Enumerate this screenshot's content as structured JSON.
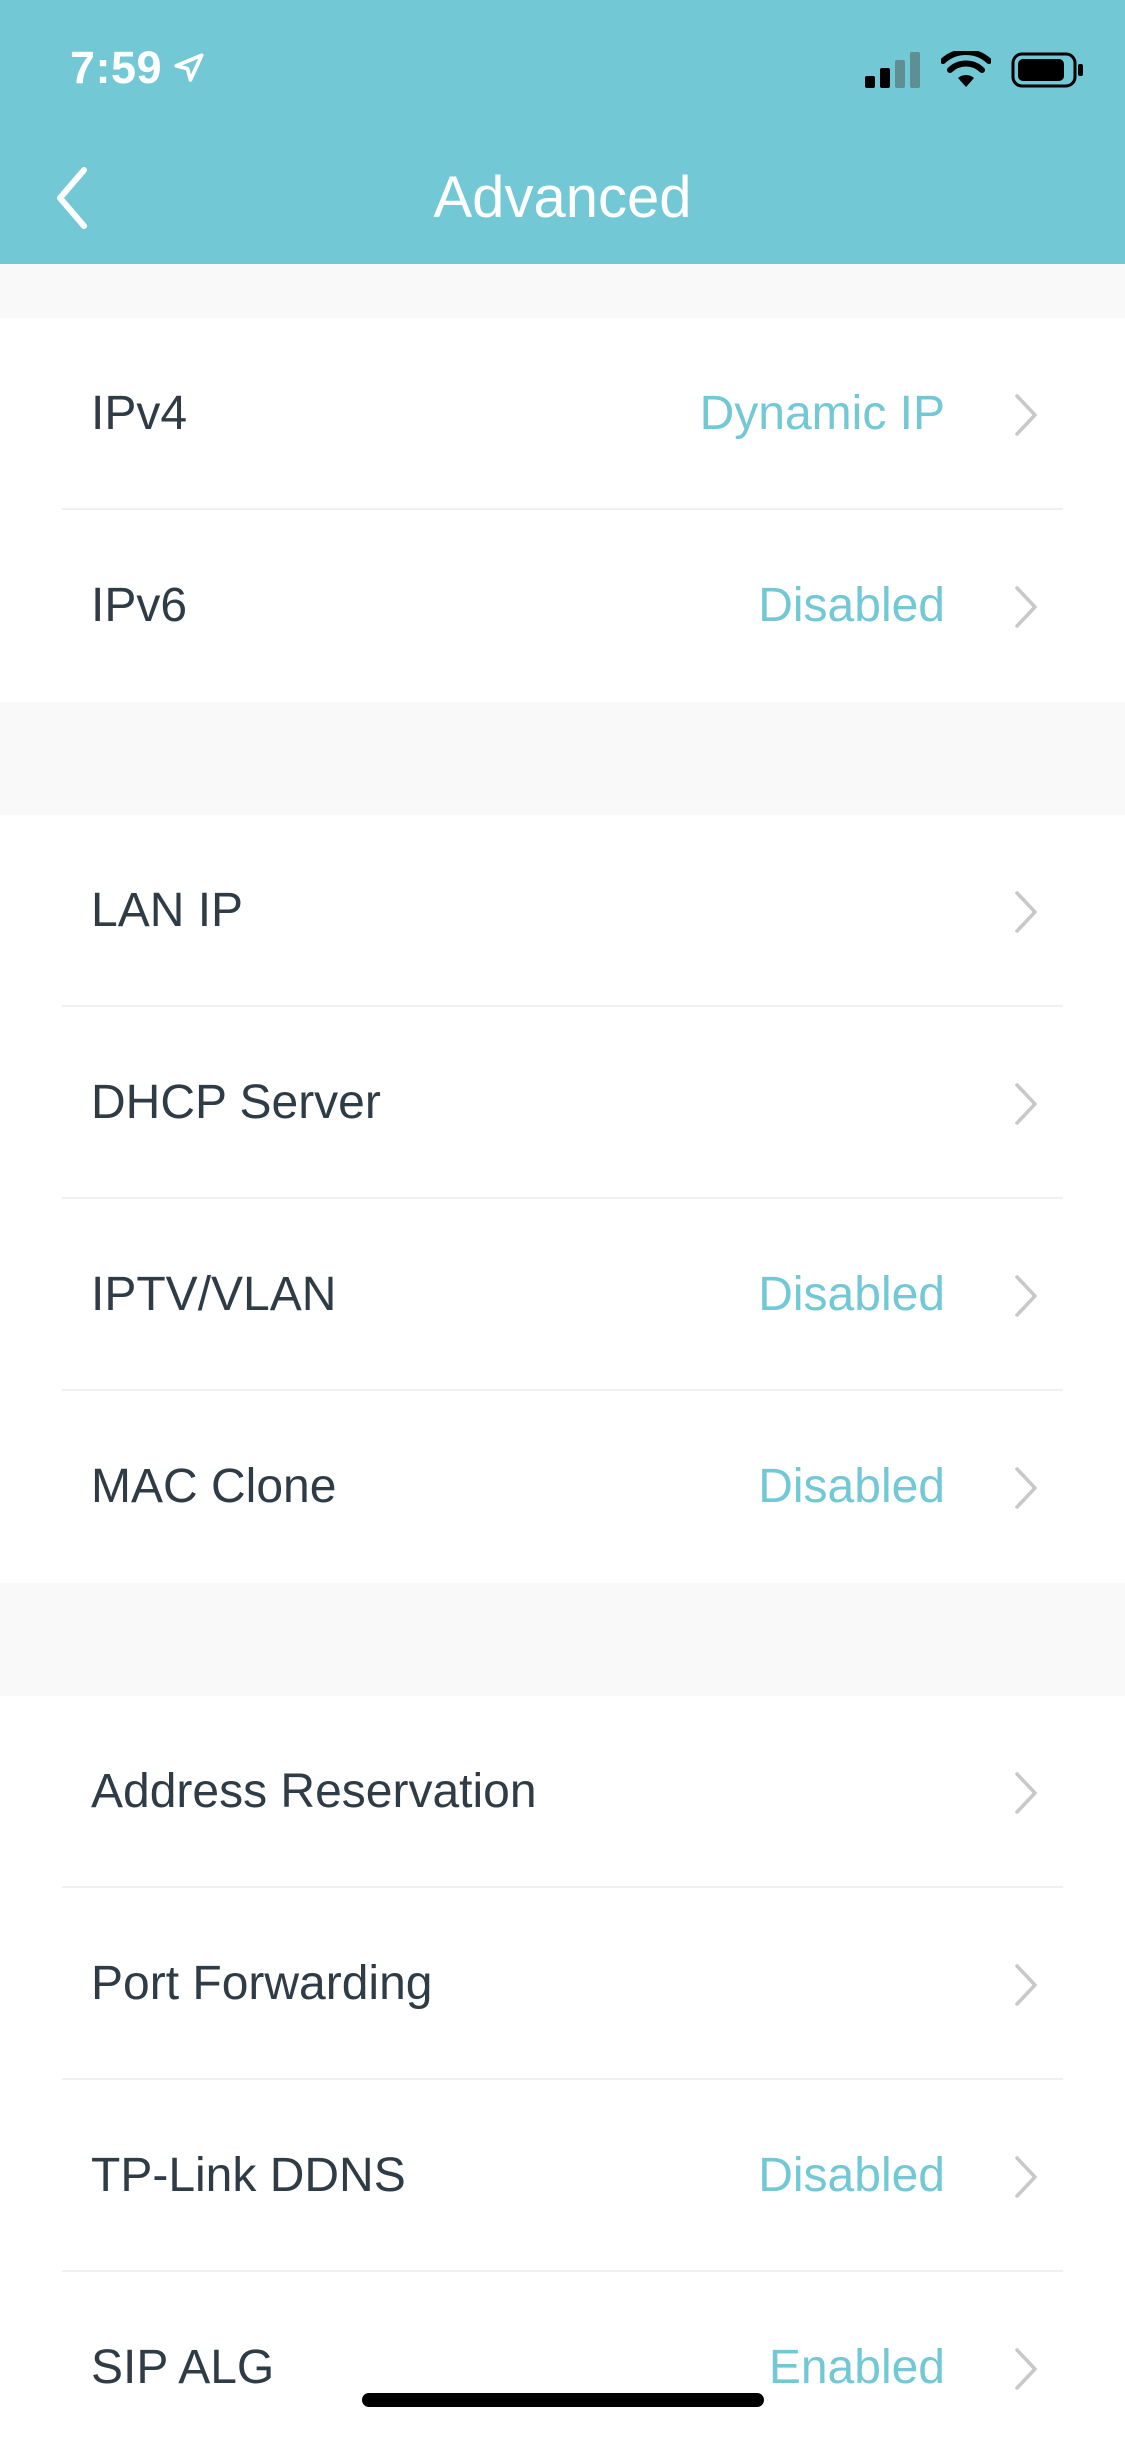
{
  "status_bar": {
    "time": "7:59"
  },
  "nav": {
    "title": "Advanced"
  },
  "colors": {
    "header": "#72c8d4",
    "accent": "#72c8d4",
    "label": "#2f3b45",
    "background": "#f9f9f9"
  },
  "groups": [
    {
      "rows": [
        {
          "label": "IPv4",
          "value": "Dynamic IP"
        },
        {
          "label": "IPv6",
          "value": "Disabled"
        }
      ]
    },
    {
      "rows": [
        {
          "label": "LAN IP",
          "value": ""
        },
        {
          "label": "DHCP Server",
          "value": ""
        },
        {
          "label": "IPTV/VLAN",
          "value": "Disabled"
        },
        {
          "label": "MAC Clone",
          "value": "Disabled"
        }
      ]
    },
    {
      "rows": [
        {
          "label": "Address Reservation",
          "value": ""
        },
        {
          "label": "Port Forwarding",
          "value": ""
        },
        {
          "label": "TP-Link DDNS",
          "value": "Disabled"
        },
        {
          "label": "SIP ALG",
          "value": "Enabled"
        }
      ]
    }
  ],
  "icons": {
    "back": "chevron-left-icon",
    "row_chevron": "chevron-right-icon",
    "location": "location-arrow-icon",
    "signal": "cellular-signal-icon",
    "wifi": "wifi-icon",
    "battery": "battery-icon"
  }
}
